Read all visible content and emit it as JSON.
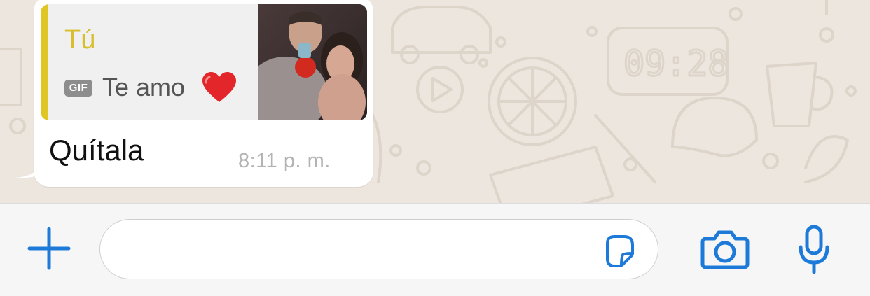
{
  "conversation": {
    "message": {
      "quoted_reply": {
        "author": "Tú",
        "media_badge": "GIF",
        "text": "Te amo",
        "emoji_icon": "red-heart-icon",
        "thumbnail": "couple-photo-thumbnail"
      },
      "text": "Quítala",
      "time": "8:11 p. m."
    }
  },
  "composer": {
    "placeholder": "",
    "value": "",
    "icons": {
      "attach": "plus-icon",
      "sticker": "sticker-icon",
      "camera": "camera-icon",
      "voice": "microphone-icon"
    }
  },
  "colors": {
    "chat_background": "#ede6df",
    "bubble": "#ffffff",
    "quote_accent": "#e0c623",
    "action_blue": "#1d7ad8",
    "timestamp": "#b3b3b3"
  }
}
